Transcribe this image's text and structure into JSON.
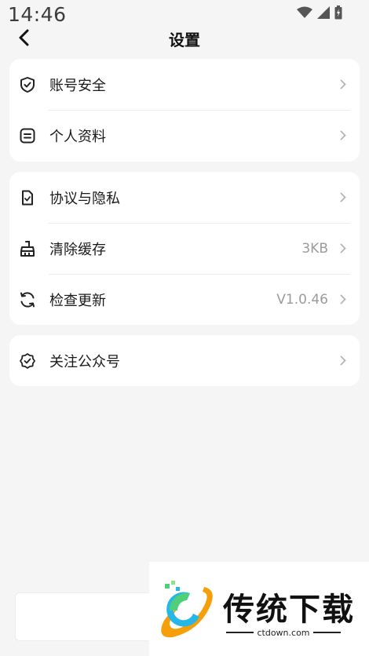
{
  "status_bar": {
    "time": "14:46",
    "icons": [
      "wifi-icon",
      "cellular-signal-icon",
      "battery-icon"
    ]
  },
  "nav": {
    "title": "设置",
    "back_icon": "chevron-left-icon"
  },
  "groups": [
    {
      "items": [
        {
          "label": "账号安全",
          "icon": "shield-check-icon",
          "value": ""
        },
        {
          "label": "个人资料",
          "icon": "profile-card-icon",
          "value": ""
        }
      ]
    },
    {
      "items": [
        {
          "label": "协议与隐私",
          "icon": "document-check-icon",
          "value": ""
        },
        {
          "label": "清除缓存",
          "icon": "broom-icon",
          "value": "3KB"
        },
        {
          "label": "检查更新",
          "icon": "refresh-icon",
          "value": "V1.0.46"
        }
      ]
    },
    {
      "items": [
        {
          "label": "关注公众号",
          "icon": "badge-check-icon",
          "value": ""
        }
      ]
    }
  ],
  "watermark": {
    "text": "传统下载",
    "url": "ctdown.com"
  },
  "colors": {
    "background": "#f5f5f5",
    "card": "#ffffff",
    "text": "#1a1a1a",
    "secondary_text": "#9b9b9b",
    "chevron": "#b5b5b5"
  }
}
